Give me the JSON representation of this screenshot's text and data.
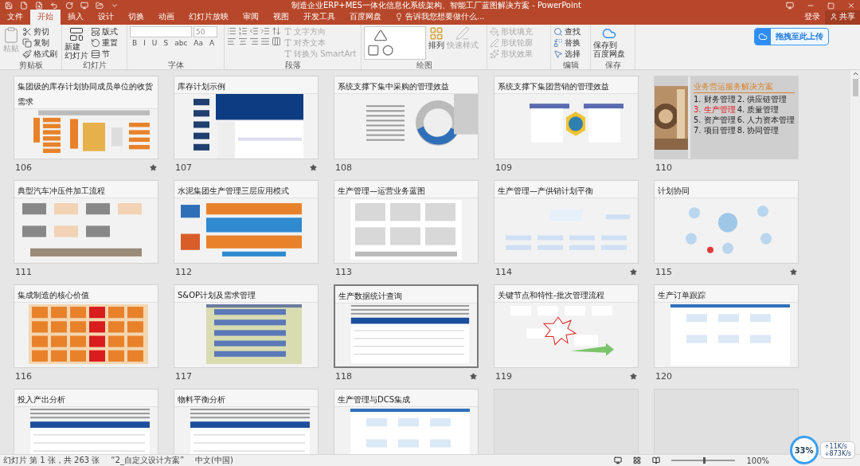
{
  "window": {
    "title": "制造企业ERP+MES一体化信息化系统架构、智能工厂蓝图解决方案 - PowerPoint"
  },
  "tabs": [
    {
      "label": "文件",
      "selected": false
    },
    {
      "label": "开始",
      "selected": true
    },
    {
      "label": "插入",
      "selected": false
    },
    {
      "label": "设计",
      "selected": false
    },
    {
      "label": "切换",
      "selected": false
    },
    {
      "label": "动画",
      "selected": false
    },
    {
      "label": "幻灯片放映",
      "selected": false
    },
    {
      "label": "审阅",
      "selected": false
    },
    {
      "label": "视图",
      "selected": false
    },
    {
      "label": "开发工具",
      "selected": false
    },
    {
      "label": "百度网盘",
      "selected": false
    }
  ],
  "tell_me": {
    "placeholder": "告诉我您想要做什么..."
  },
  "account": {
    "sign_in": "登录",
    "share": "共享"
  },
  "ribbon": {
    "clipboard": {
      "label": "剪贴板",
      "paste": {
        "label": "粘贴",
        "disabled": true
      },
      "items": [
        "剪切",
        "复制",
        "格式刷"
      ]
    },
    "slides": {
      "label": "幻灯片",
      "new_slide": [
        "新建",
        "幻灯片"
      ],
      "items": [
        "版式",
        "重置",
        "节"
      ]
    },
    "font": {
      "label": "字体",
      "size": "50",
      "format_buttons": [
        "B",
        "I",
        "U",
        "S",
        "abc",
        "Aa",
        "A"
      ]
    },
    "paragraph": {
      "label": "段落",
      "items": [
        {
          "label": "文字方向",
          "disabled": true
        },
        {
          "label": "对齐文本",
          "disabled": true
        },
        {
          "label": "转换为 SmartArt",
          "disabled": true
        }
      ]
    },
    "drawing": {
      "label": "绘图",
      "arrange": "排列",
      "quick_styles": {
        "label": "快速样式",
        "disabled": true
      },
      "items": [
        {
          "label": "形状填充",
          "disabled": true
        },
        {
          "label": "形状轮廓",
          "disabled": true
        },
        {
          "label": "形状效果",
          "disabled": true
        }
      ]
    },
    "editing": {
      "label": "编辑",
      "items": [
        "查找",
        "替换",
        "选择"
      ]
    },
    "save": {
      "label": "保存",
      "button": [
        "保存到",
        "百度网盘"
      ]
    },
    "upload": "拖拽至此上传"
  },
  "slides": [
    {
      "number": "106",
      "title": "集团级的库存计划协同成员单位的收货需求",
      "kind": "orange",
      "starred": true,
      "selected": false
    },
    {
      "number": "107",
      "title": "库存计划示例",
      "kind": "blue",
      "starred": true,
      "selected": false
    },
    {
      "number": "108",
      "title": "系统支撑下集中采购的管理效益",
      "kind": "ring",
      "starred": false,
      "selected": false
    },
    {
      "number": "109",
      "title": "系统支撑下集团营销的管理效益",
      "kind": "hex",
      "starred": false,
      "selected": false
    },
    {
      "number": "110",
      "heading": "业务营运服务解决方案",
      "list": [
        {
          "n": "1.",
          "text": "财务管理",
          "highlighted": false
        },
        {
          "n": "2.",
          "text": "供应链管理",
          "highlighted": false
        },
        {
          "n": "3.",
          "text": "生产管理",
          "highlighted": true
        },
        {
          "n": "4.",
          "text": "质量管理",
          "highlighted": false
        },
        {
          "n": "5.",
          "text": "资产管理",
          "highlighted": false
        },
        {
          "n": "6.",
          "text": "人力资本管理",
          "highlighted": false
        },
        {
          "n": "7.",
          "text": "项目管理",
          "highlighted": false
        },
        {
          "n": "8.",
          "text": "协同管理",
          "highlighted": false
        }
      ],
      "starred": false,
      "selected": false
    },
    {
      "number": "111",
      "title": "典型汽车冲压件加工流程",
      "kind": "flow",
      "starred": false,
      "selected": false
    },
    {
      "number": "112",
      "title": "水泥集团生产管理三层应用模式",
      "kind": "layers",
      "starred": false,
      "selected": false
    },
    {
      "number": "113",
      "title": "生产管理—运营业务蓝图",
      "kind": "blueprint",
      "starred": false,
      "selected": false
    },
    {
      "number": "114",
      "title": "生产管理—产供销计划平衡",
      "kind": "tree",
      "starred": true,
      "selected": false
    },
    {
      "number": "115",
      "title": "计划协同",
      "kind": "network",
      "starred": true,
      "selected": false
    },
    {
      "number": "116",
      "title": "集成制造的核心价值",
      "kind": "grid",
      "starred": false,
      "selected": false
    },
    {
      "number": "117",
      "title": "S&OP计划及需求管理",
      "kind": "sop",
      "starred": false,
      "selected": false
    },
    {
      "number": "118",
      "title": "生产数据统计查询",
      "kind": "table",
      "starred": true,
      "selected": true
    },
    {
      "number": "119",
      "title": "关键节点和特性-批次管理流程",
      "kind": "burst",
      "starred": true,
      "selected": false
    },
    {
      "number": "120",
      "title": "生产订单跟踪",
      "kind": "app",
      "starred": false,
      "selected": false
    },
    {
      "title": "投入产出分析",
      "kind": "table",
      "starred": false,
      "selected": false
    },
    {
      "title": "物料平衡分析",
      "kind": "table",
      "starred": false,
      "selected": false
    },
    {
      "title": "生产管理与DCS集成",
      "kind": "app",
      "starred": false,
      "selected": false
    },
    {
      "kind": "blank",
      "starred": false,
      "selected": false
    },
    {
      "kind": "blank",
      "starred": false,
      "selected": false
    }
  ],
  "status_bar": {
    "slide": "幻灯片 第 1 张，共 263 张",
    "theme": "“2_自定义设计方案”",
    "language": "中文(中国)",
    "zoom": {
      "level": 0.5,
      "reading": "100%"
    }
  },
  "speed_widget": {
    "percent": "33%",
    "upload": "11K/s",
    "download": "873K/s"
  }
}
